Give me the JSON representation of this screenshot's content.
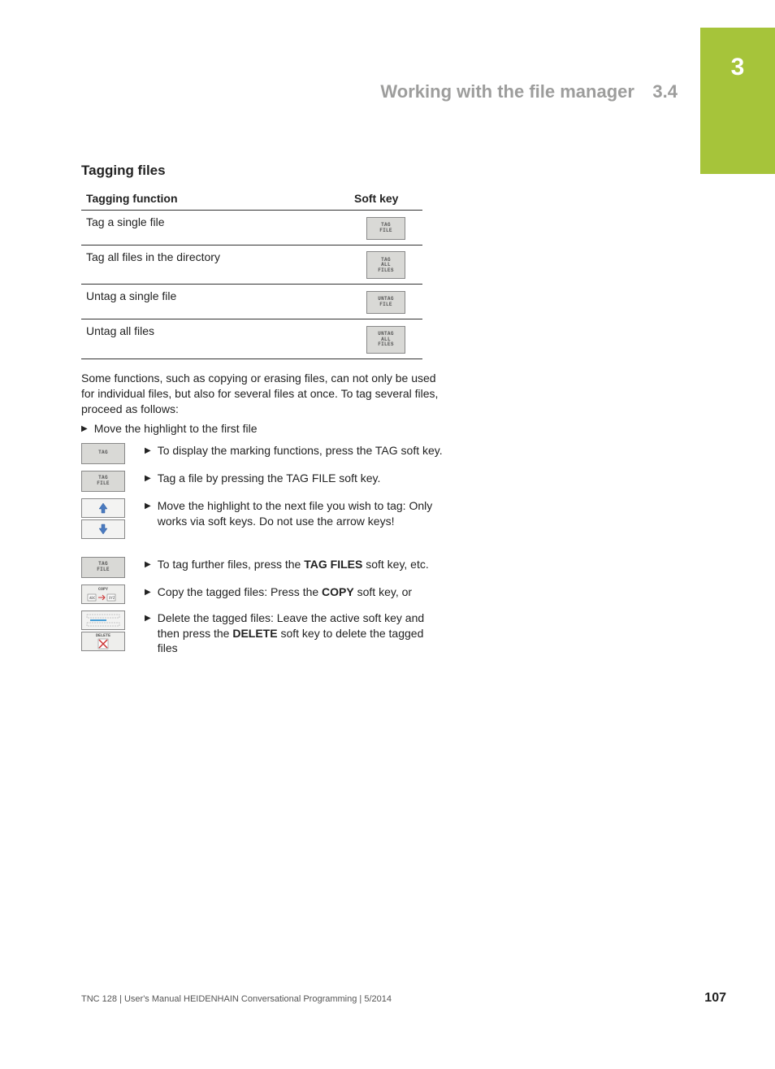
{
  "chapter_tab": "3",
  "header": {
    "title": "Working with the file manager",
    "section": "3.4"
  },
  "section_heading": "Tagging files",
  "table": {
    "col1": "Tagging function",
    "col2": "Soft key",
    "rows": [
      {
        "label": "Tag a single file",
        "key_lines": [
          "TAG",
          "FILE"
        ]
      },
      {
        "label": "Tag all files in the directory",
        "key_lines": [
          "TAG",
          "ALL",
          "FILES"
        ]
      },
      {
        "label": "Untag a single file",
        "key_lines": [
          "UNTAG",
          "FILE"
        ]
      },
      {
        "label": "Untag all files",
        "key_lines": [
          "UNTAG",
          "ALL",
          "FILES"
        ]
      }
    ]
  },
  "intro_para": "Some functions, such as copying or erasing files, can not only be used for individual files, but also for several files at once. To tag several files, proceed as follows:",
  "first_bullet": "Move the highlight to the first file",
  "steps": [
    {
      "keys": [
        {
          "type": "softkey",
          "lines": [
            "TAG"
          ]
        }
      ],
      "text_pre": "To display the marking functions, press the TAG soft key."
    },
    {
      "keys": [
        {
          "type": "softkey",
          "lines": [
            "TAG",
            "FILE"
          ]
        }
      ],
      "text_pre": "Tag a file by pressing the TAG FILE soft key."
    },
    {
      "keys": [
        {
          "type": "arrow-up"
        },
        {
          "type": "arrow-down"
        }
      ],
      "text_pre": "Move the highlight to the next file you wish to tag: Only works via soft keys. Do not use the arrow keys!"
    },
    {
      "keys": [
        {
          "type": "softkey",
          "lines": [
            "TAG",
            "FILE"
          ]
        }
      ],
      "text_pre": "To tag further files, press the ",
      "bold": "TAG FILES",
      "text_post": " soft key, etc."
    },
    {
      "keys": [
        {
          "type": "copy"
        }
      ],
      "text_pre": "Copy the tagged files: Press the ",
      "bold": "COPY",
      "text_post": " soft key, or"
    },
    {
      "keys": [
        {
          "type": "blank"
        },
        {
          "type": "delete"
        }
      ],
      "text_pre": "Delete the tagged files: Leave the active soft key and then press the ",
      "bold": "DELETE",
      "text_post": " soft key to delete the tagged files"
    }
  ],
  "footer": {
    "left": "TNC 128 | User's Manual HEIDENHAIN Conversational Programming | 5/2014",
    "page": "107"
  }
}
